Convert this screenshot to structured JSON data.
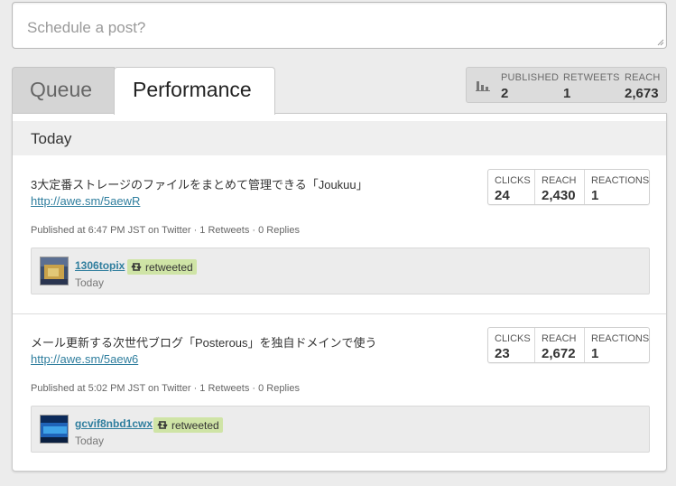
{
  "composer": {
    "placeholder": "Schedule a post?"
  },
  "tabs": [
    {
      "label": "Queue",
      "active": false
    },
    {
      "label": "Performance",
      "active": true
    }
  ],
  "summary": {
    "icon": "bar-chart-icon",
    "published_label": "PUBLISHED",
    "published_value": "2",
    "retweets_label": "RETWEETS",
    "retweets_value": "1",
    "reach_label": "REACH",
    "reach_value": "2,673"
  },
  "section_title": "Today",
  "metric_labels": {
    "clicks": "CLICKS",
    "reach": "REACH",
    "reactions": "REACTIONS"
  },
  "posts": [
    {
      "title": "3大定番ストレージのファイルをまとめて管理できる「Joukuu」",
      "link": "http://awe.sm/5aewR",
      "meta": "Published at 6:47 PM JST on Twitter · 1 Retweets · 0 Replies",
      "clicks": "24",
      "reach": "2,430",
      "reactions": "1",
      "retweet": {
        "user": "1306topix",
        "badge": "retweeted",
        "when": "Today"
      }
    },
    {
      "title": "メール更新する次世代ブログ「Posterous」を独自ドメインで使う",
      "link": "http://awe.sm/5aew6",
      "meta": "Published at 5:02 PM JST on Twitter · 1 Retweets · 0 Replies",
      "clicks": "23",
      "reach": "2,672",
      "reactions": "1",
      "retweet": {
        "user": "gcvif8nbd1cwx",
        "badge": "retweeted",
        "when": "Today"
      }
    }
  ],
  "colors": {
    "link": "#2f7e9e",
    "retweet_badge": "#cfe4a6",
    "tab_inactive": "#d5d5d5"
  }
}
